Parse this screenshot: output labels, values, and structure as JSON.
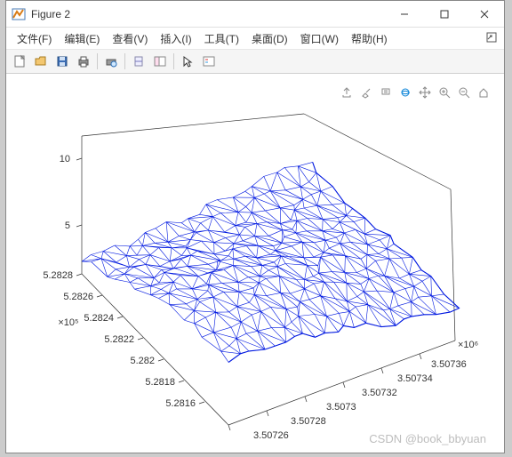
{
  "window": {
    "title": "Figure 2",
    "min": "–",
    "max": "□",
    "close": "✕"
  },
  "menu": {
    "file": "文件(F)",
    "edit": "编辑(E)",
    "view": "查看(V)",
    "insert": "插入(I)",
    "tools": "工具(T)",
    "desktop": "桌面(D)",
    "window": "窗口(W)",
    "help": "帮助(H)"
  },
  "toolbar_icons": [
    "new",
    "open",
    "save",
    "print",
    "sep",
    "print-preview",
    "sep",
    "link",
    "edit-plot",
    "sep",
    "cursor",
    "insert-legend"
  ],
  "axes_toolbar": [
    "export",
    "brush",
    "datatip",
    "rotate3d",
    "pan",
    "zoom-in",
    "zoom-out",
    "home"
  ],
  "chart_data": {
    "type": "mesh3d",
    "title": "",
    "x": {
      "ticks": [
        3.50726,
        3.50728,
        3.5073,
        3.50732,
        3.50734,
        3.50736
      ],
      "multiplier_label": "×10⁶",
      "range": [
        3.50726,
        3.50736
      ]
    },
    "y": {
      "ticks": [
        5.2816,
        5.2818,
        5.282,
        5.2822,
        5.2824,
        5.2826,
        5.2828
      ],
      "multiplier_label": "×10⁵",
      "range": [
        5.2816,
        5.2828
      ]
    },
    "z": {
      "ticks": [
        5,
        10
      ],
      "range": [
        0,
        10
      ]
    },
    "surface": "irregular triangulated terrain mesh, blue wireframe, z approx 3–8, undulating"
  },
  "watermark": "CSDN @book_bbyuan"
}
